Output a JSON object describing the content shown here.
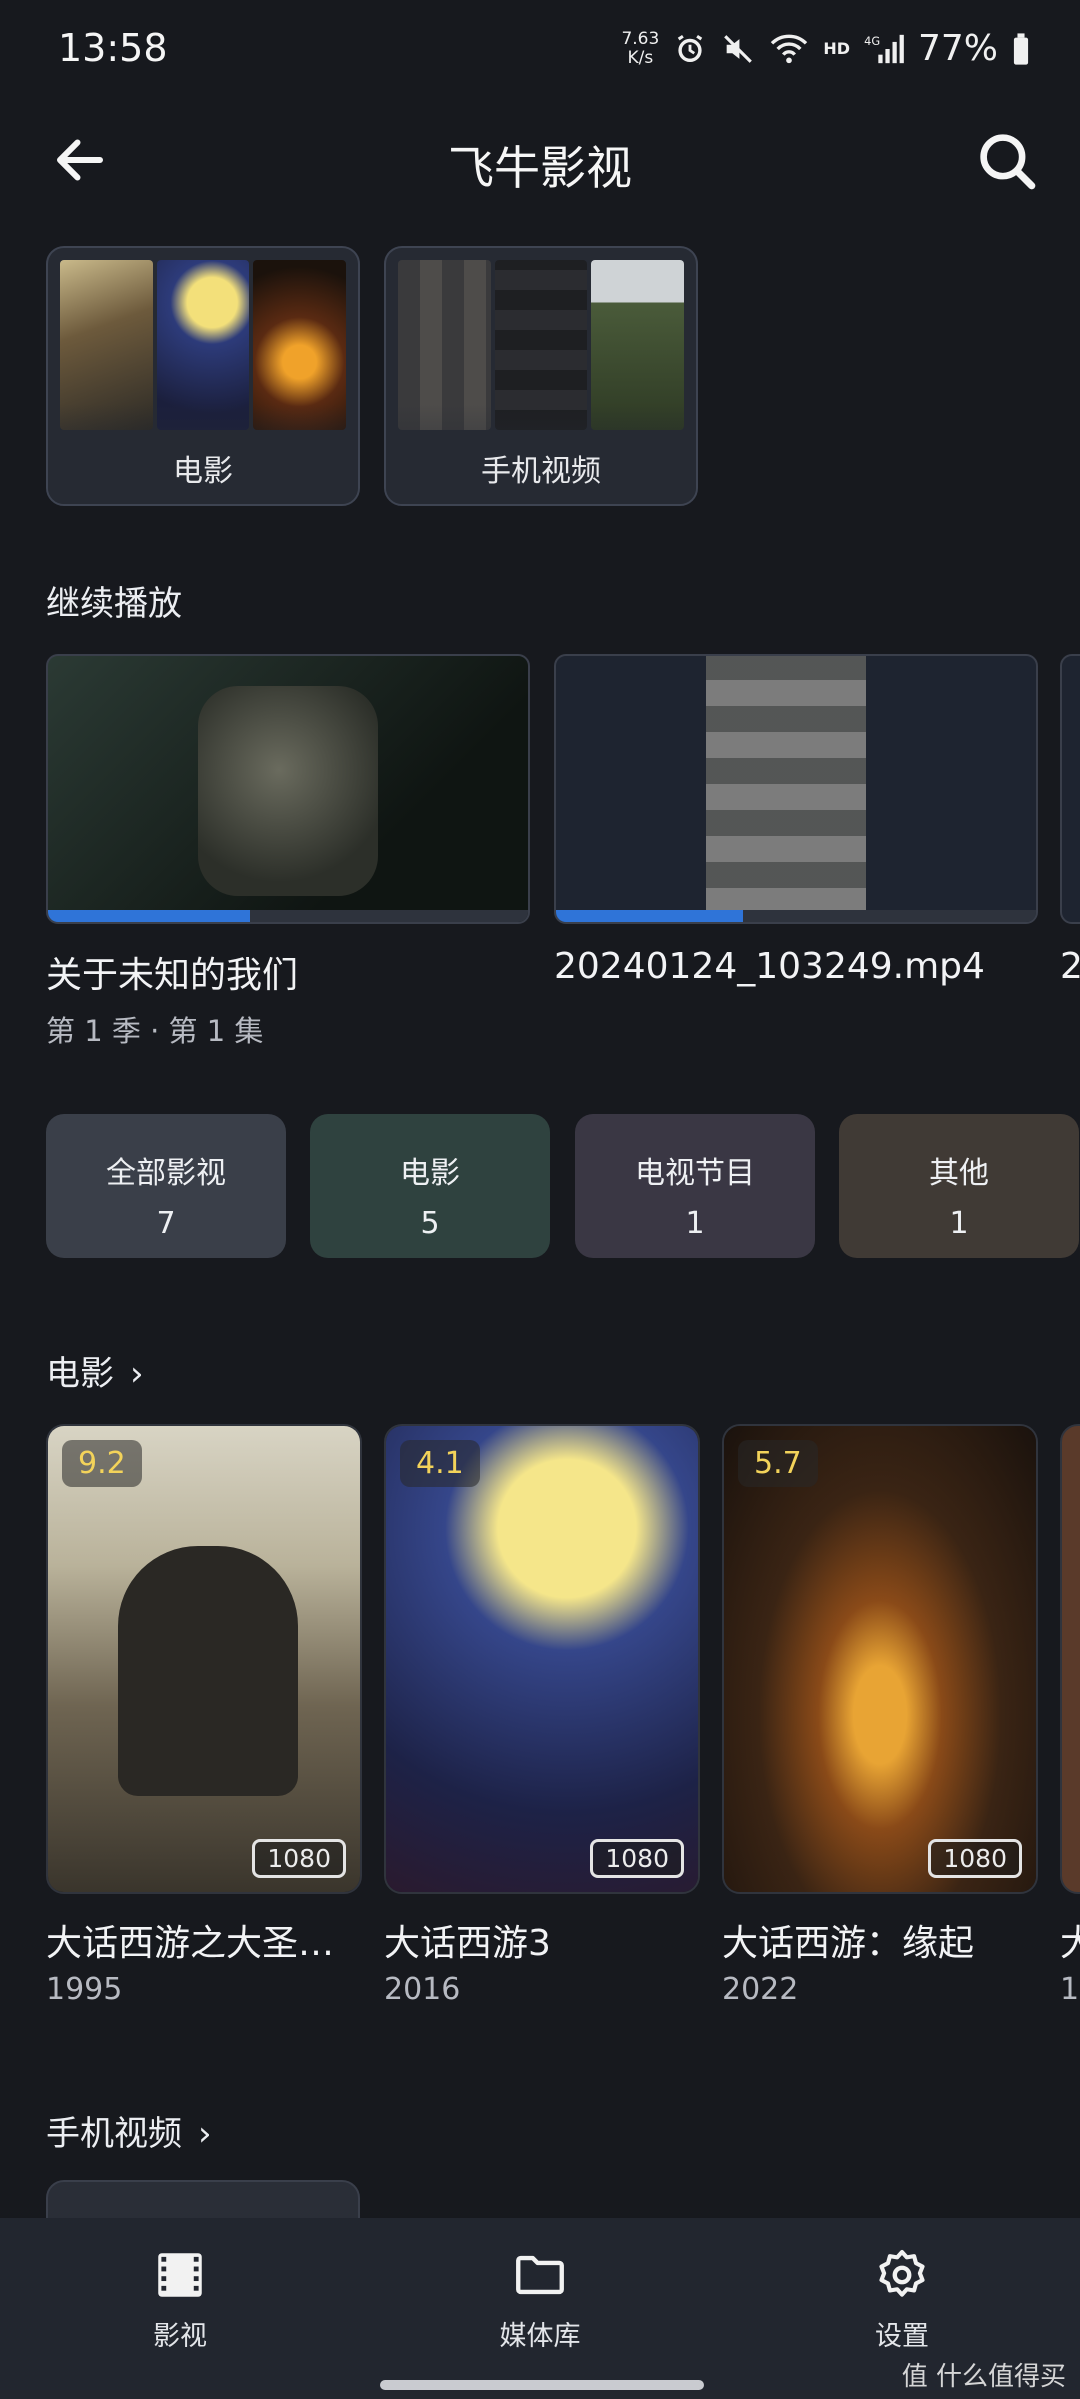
{
  "status_bar": {
    "time": "13:58",
    "speed_value": "7.63",
    "speed_unit": "K/s",
    "battery": "77%"
  },
  "header": {
    "title": "飞牛影视"
  },
  "libraries": [
    {
      "label": "电影"
    },
    {
      "label": "手机视频"
    }
  ],
  "continue_watching": {
    "title": "继续播放",
    "items": [
      {
        "title": "关于未知的我们",
        "subtitle": "第 1 季 · 第 1 集",
        "progress": 0.42
      },
      {
        "title": "20240124_103249.mp4",
        "subtitle": "",
        "progress": 0.39
      },
      {
        "title": "2",
        "subtitle": "",
        "progress": 0
      }
    ]
  },
  "categories": [
    {
      "name": "全部影视",
      "count": "7",
      "color": "#3a3f49"
    },
    {
      "name": "电影",
      "count": "5",
      "color": "#2f423f"
    },
    {
      "name": "电视节目",
      "count": "1",
      "color": "#3a3744"
    },
    {
      "name": "其他",
      "count": "1",
      "color": "#403a35"
    }
  ],
  "movies_section": {
    "title": "电影",
    "items": [
      {
        "title": "大话西游之大圣…",
        "year": "1995",
        "rating": "9.2",
        "resolution": "1080"
      },
      {
        "title": "大话西游3",
        "year": "2016",
        "rating": "4.1",
        "resolution": "1080"
      },
      {
        "title": "大话西游：缘起",
        "year": "2022",
        "rating": "5.7",
        "resolution": "1080"
      },
      {
        "title": "大",
        "year": "19",
        "rating": "",
        "resolution": ""
      }
    ]
  },
  "phone_videos_section": {
    "title": "手机视频"
  },
  "bottom_nav": [
    {
      "label": "影视",
      "icon": "film-icon"
    },
    {
      "label": "媒体库",
      "icon": "folder-icon"
    },
    {
      "label": "设置",
      "icon": "gear-icon"
    }
  ],
  "watermark": "值 什么值得买"
}
